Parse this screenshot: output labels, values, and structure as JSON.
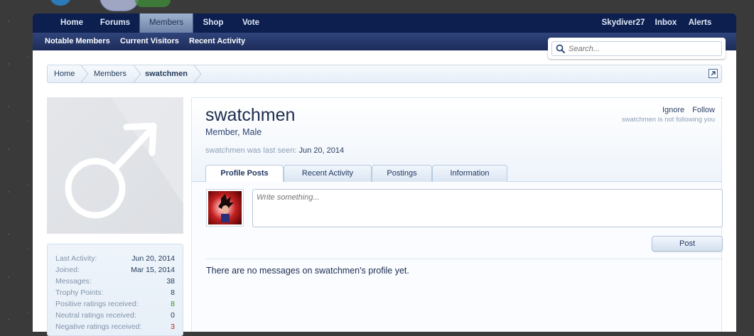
{
  "nav": {
    "tabs": [
      {
        "label": "Home"
      },
      {
        "label": "Forums"
      },
      {
        "label": "Members"
      },
      {
        "label": "Shop"
      },
      {
        "label": "Vote"
      }
    ],
    "user": "Skydiver27",
    "inbox": "Inbox",
    "alerts": "Alerts"
  },
  "subnav": {
    "items": [
      "Notable Members",
      "Current Visitors",
      "Recent Activity"
    ]
  },
  "search": {
    "placeholder": "Search..."
  },
  "breadcrumb": [
    "Home",
    "Members",
    "swatchmen"
  ],
  "profile": {
    "username": "swatchmen",
    "title": "Member, Male",
    "last_seen_label": "swatchmen was last seen:",
    "last_seen_date": "Jun 20, 2014",
    "ignore": "Ignore",
    "follow": "Follow",
    "follow_status": "swatchmen is not following you"
  },
  "tabs": [
    "Profile Posts",
    "Recent Activity",
    "Postings",
    "Information"
  ],
  "stats": [
    {
      "label": "Last Activity:",
      "value": "Jun 20, 2014",
      "color": "#243b5c"
    },
    {
      "label": "Joined:",
      "value": "Mar 15, 2014",
      "color": "#243b5c"
    },
    {
      "label": "Messages:",
      "value": "38",
      "color": "#243b5c"
    },
    {
      "label": "Trophy Points:",
      "value": "8",
      "color": "#243b5c"
    },
    {
      "label": "Positive ratings received:",
      "value": "8",
      "color": "#3a8a1f"
    },
    {
      "label": "Neutral ratings received:",
      "value": "0",
      "color": "#243b5c"
    },
    {
      "label": "Negative ratings received:",
      "value": "3",
      "color": "#c0221d"
    }
  ],
  "composer": {
    "placeholder": "Write something...",
    "post_label": "Post"
  },
  "empty_message": "There are no messages on swatchmen's profile yet."
}
